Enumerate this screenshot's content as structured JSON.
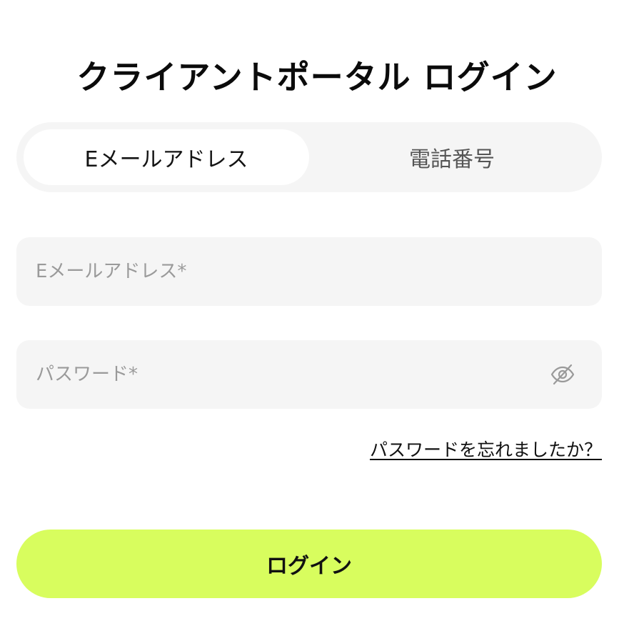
{
  "header": {
    "title": "クライアントポータル ログイン"
  },
  "tabs": [
    {
      "label": "Eメールアドレス",
      "active": true
    },
    {
      "label": "電話番号",
      "active": false
    }
  ],
  "form": {
    "email": {
      "placeholder": "Eメールアドレス*",
      "value": ""
    },
    "password": {
      "placeholder": "パスワード*",
      "value": "",
      "toggle_icon": "eye-off-icon"
    },
    "forgot_label": "パスワードを忘れましたか？",
    "submit_label": "ログイン"
  },
  "colors": {
    "accent": "#d8fd5e",
    "field_background": "#f5f5f5",
    "placeholder": "#9a9a9a"
  }
}
